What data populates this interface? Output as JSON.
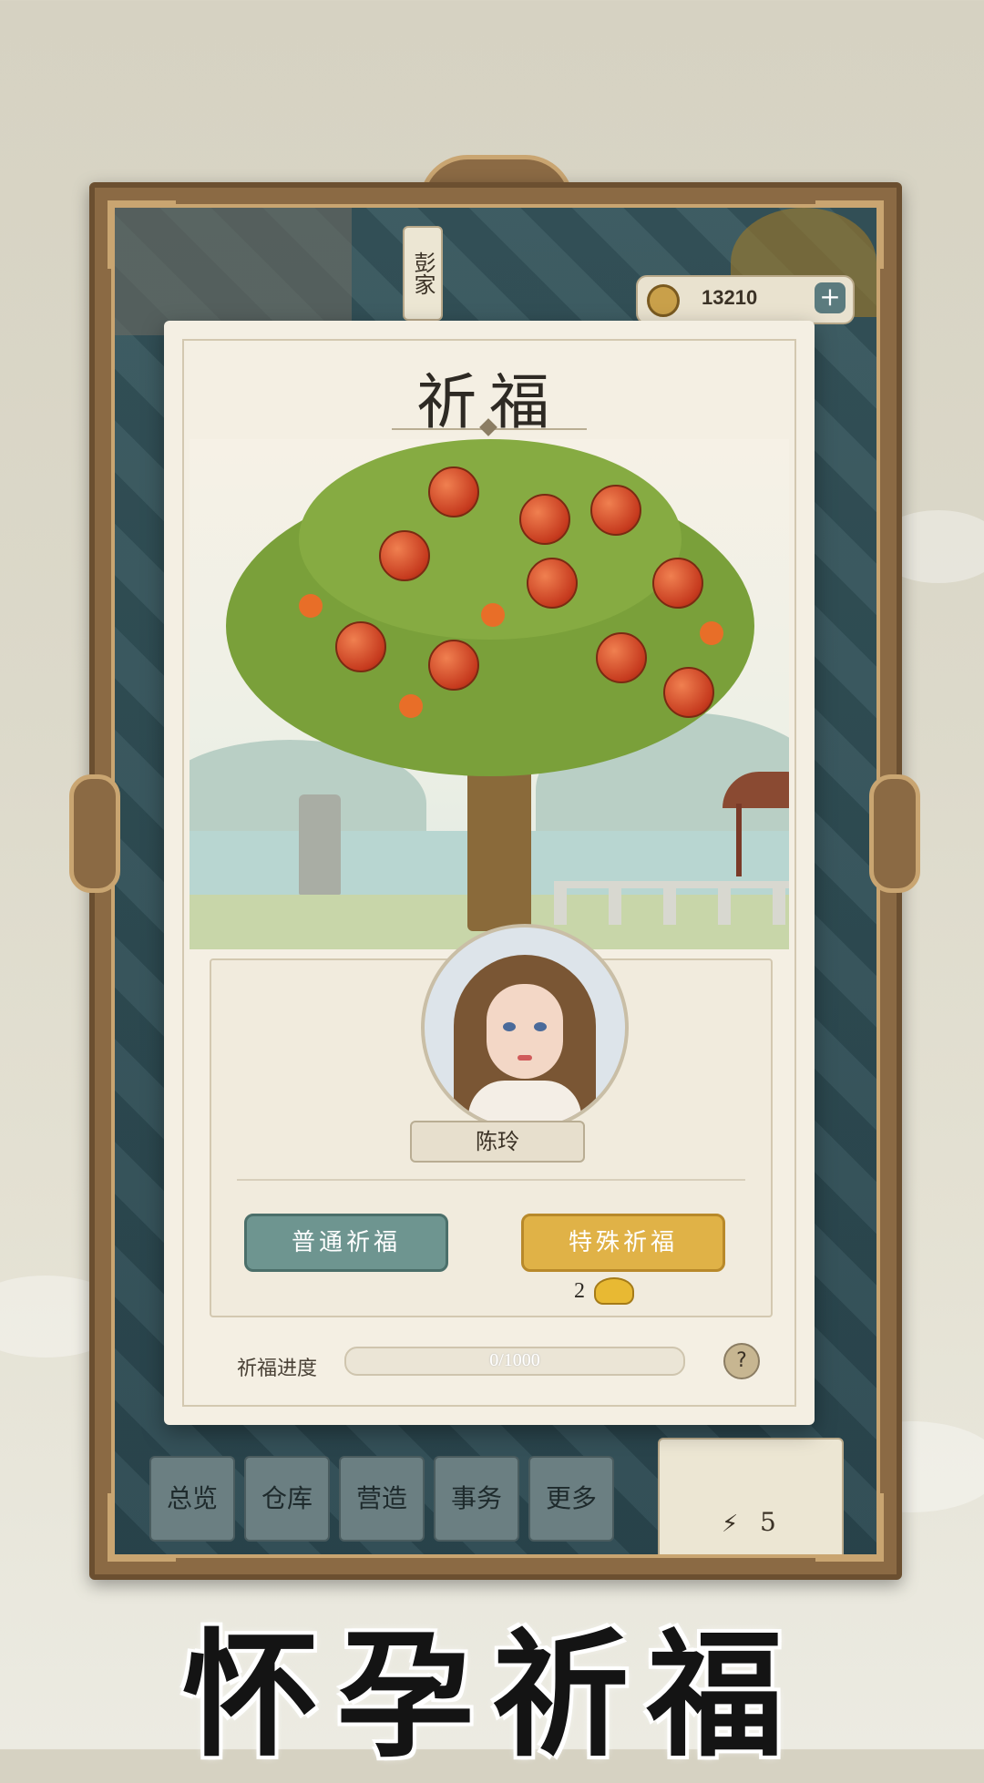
{
  "background": {
    "family_name": "彭家",
    "currency": {
      "amount": "13210",
      "plus": "+"
    },
    "bottom_nav": [
      "总览",
      "仓库",
      "营造",
      "事务",
      "更多"
    ],
    "stat": {
      "icon": "lightning-icon",
      "value": "5"
    }
  },
  "modal": {
    "title": "祈福",
    "character_name": "陈玲",
    "buttons": {
      "normal": "普通祈福",
      "special": "特殊祈福"
    },
    "special_cost": {
      "amount": "2",
      "icon": "gold-ingot-icon"
    },
    "progress": {
      "label": "祈福进度",
      "text": "0/1000",
      "current": 0,
      "max": 1000
    },
    "help": "?"
  },
  "caption": "怀孕祈福",
  "colors": {
    "frame": "#8b6a44",
    "frame_trim": "#c9a571",
    "normal_button": "#6e9590",
    "special_button": "#e0b247"
  }
}
